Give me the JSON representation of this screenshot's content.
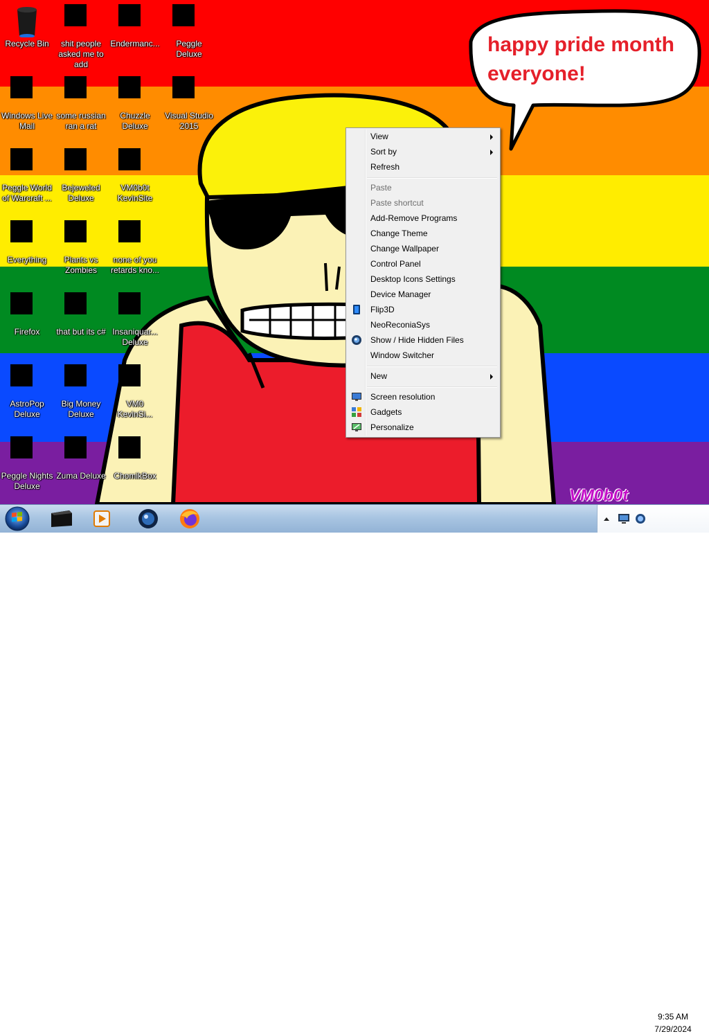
{
  "colors": {
    "pride_red": "#ff0000",
    "pride_orange": "#ff8c00",
    "pride_yellow": "#ffed00",
    "pride_green": "#008a21",
    "pride_blue": "#0a4aff",
    "pride_purple": "#7a1ea0",
    "bubble_text": "#e5202a",
    "skin": "#fbf2b6",
    "hair": "#fbf10a",
    "shirt": "#ec1c2b"
  },
  "bubble": {
    "text_line1": "happy pride month",
    "text_line2": "everyone!"
  },
  "signature": "VM0b0t",
  "desktop_icons": [
    {
      "label": "Recycle Bin",
      "icon": "recycle-bin-icon"
    },
    {
      "label": "Windows Live Mail",
      "icon": "mail-icon"
    },
    {
      "label": "Peggle World of Warcraft ...",
      "icon": "peggle-icon"
    },
    {
      "label": "Everything",
      "icon": "search-icon"
    },
    {
      "label": "Firefox",
      "icon": "firefox-icon"
    },
    {
      "label": "AstroPop Deluxe",
      "icon": "game-icon"
    },
    {
      "label": "Peggle Nights Deluxe",
      "icon": "peggle-icon"
    },
    {
      "label": "shit people asked me to add",
      "icon": "folder-icon"
    },
    {
      "label": "some russian ran a rat",
      "icon": "app-icon"
    },
    {
      "label": "Bejeweled Deluxe",
      "icon": "gem-icon"
    },
    {
      "label": "Plants vs Zombies",
      "icon": "plant-icon"
    },
    {
      "label": "that but its c#",
      "icon": "app-icon"
    },
    {
      "label": "Big Money Deluxe",
      "icon": "money-bag-icon"
    },
    {
      "label": "Zuma Deluxe",
      "icon": "zuma-icon"
    },
    {
      "label": "Endermanc...",
      "icon": "window-icon"
    },
    {
      "label": "Chuzzle Deluxe",
      "icon": "game-icon"
    },
    {
      "label": "VM0b0t KevinSite",
      "icon": "app-icon"
    },
    {
      "label": "none of you retards kno...",
      "icon": "app-icon"
    },
    {
      "label": "Insaniquar... Deluxe",
      "icon": "fish-icon"
    },
    {
      "label": "VM0 KevinSi...",
      "icon": "app-icon"
    },
    {
      "label": "ChomikBox",
      "icon": "hamster-icon"
    },
    {
      "label": "Peggle Deluxe",
      "icon": "peggle-icon"
    },
    {
      "label": "Visual Studio 2015",
      "icon": "visual-studio-icon"
    }
  ],
  "context_menu": {
    "view": "View",
    "sort_by": "Sort by",
    "refresh": "Refresh",
    "paste": "Paste",
    "paste_shortcut": "Paste shortcut",
    "add_remove_programs": "Add-Remove Programs",
    "change_theme": "Change Theme",
    "change_wallpaper": "Change Wallpaper",
    "control_panel": "Control Panel",
    "desktop_icons_settings": "Desktop Icons Settings",
    "device_manager": "Device Manager",
    "flip3d": "Flip3D",
    "neoreconiasys": "NeoReconiaSys",
    "show_hide_hidden_files": "Show / Hide Hidden Files",
    "window_switcher": "Window Switcher",
    "new": "New",
    "screen_resolution": "Screen resolution",
    "gadgets": "Gadgets",
    "personalize": "Personalize"
  },
  "taskbar": {
    "pinned": [
      "terminal-icon",
      "media-player-icon",
      "globe-icon",
      "firefox-icon"
    ],
    "clock_time": "9:35 AM",
    "clock_date": "7/29/2024"
  }
}
